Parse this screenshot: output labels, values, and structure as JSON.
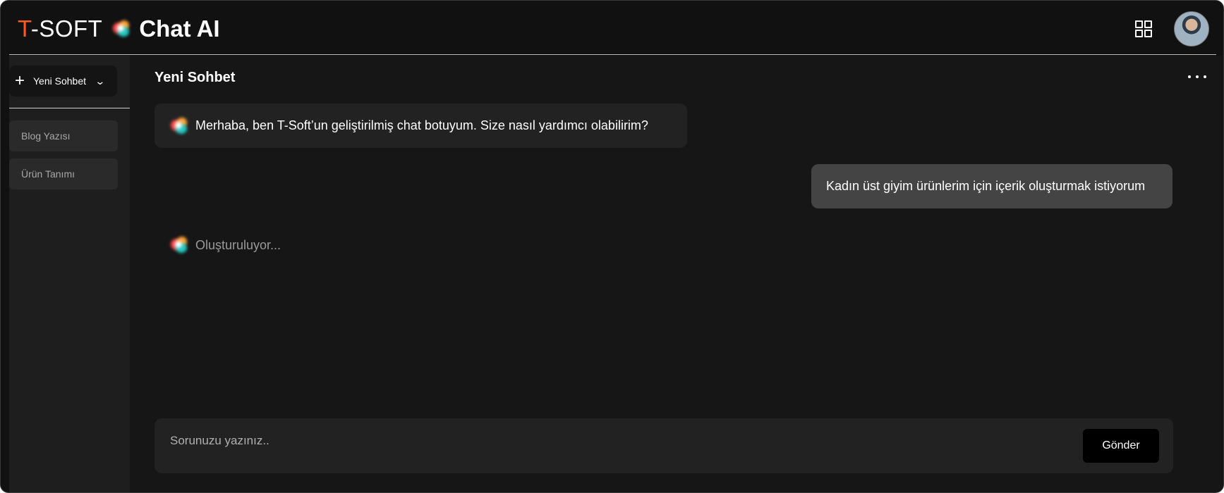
{
  "header": {
    "brand_t": "T",
    "brand_rest": "-SOFT",
    "product": "Chat AI",
    "icons": {
      "logo_mark": "gradient-orb-icon",
      "apps": "grid-icon",
      "avatar": "user-avatar"
    }
  },
  "sidebar": {
    "new_chat_label": "Yeni Sohbet",
    "new_chat_icons": {
      "plus": "plus-icon",
      "dropdown": "chevron-down-icon"
    },
    "items": [
      {
        "label": "Blog Yazısı"
      },
      {
        "label": "Ürün Tanımı"
      }
    ]
  },
  "main": {
    "title": "Yeni Sohbet",
    "more_icon": "more-horizontal-icon",
    "messages": [
      {
        "role": "bot",
        "text": "Merhaba, ben T-Soft’un geliştirilmiş chat botuyum. Size nasıl yardımcı olabilirim?"
      },
      {
        "role": "user",
        "text": "Kadın üst giyim ürünlerim için içerik oluşturmak istiyorum"
      }
    ],
    "loading_text": "Oluşturuluyor..."
  },
  "composer": {
    "placeholder": "Sorunuzu yazınız..",
    "value": "",
    "send_label": "Gönder"
  },
  "colors": {
    "background": "#111111",
    "sidebar": "#1e1e1e",
    "main": "#161616",
    "brand_accent": "#ff5a1f",
    "bot_bubble": "#222222",
    "user_bubble": "#444444"
  }
}
